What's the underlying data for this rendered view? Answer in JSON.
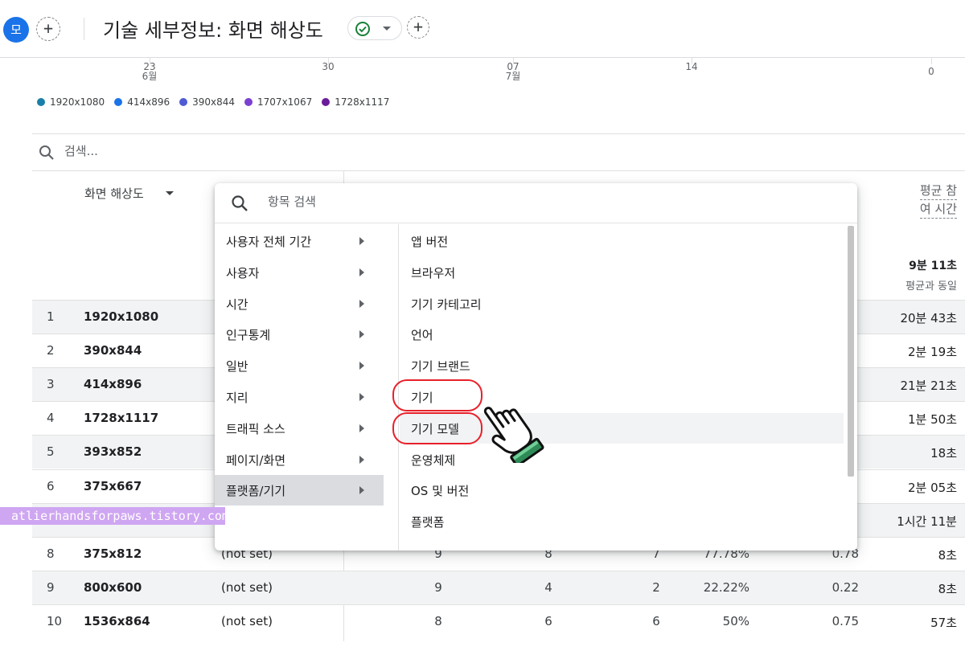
{
  "header": {
    "avatar_label": "모",
    "add_label": "+",
    "title": "기술 세부정보: 화면 해상도",
    "add_comparison_label": "+"
  },
  "chart_axis": {
    "ticks": [
      {
        "label": "23",
        "sub": "6월"
      },
      {
        "label": "30",
        "sub": ""
      },
      {
        "label": "07",
        "sub": "7월"
      },
      {
        "label": "14",
        "sub": ""
      },
      {
        "label": "0",
        "sub": ""
      }
    ]
  },
  "legend": [
    {
      "label": "1920x1080",
      "color": "#1a7fa8"
    },
    {
      "label": "414x896",
      "color": "#1a73e8"
    },
    {
      "label": "390x844",
      "color": "#4f5bd5"
    },
    {
      "label": "1707x1067",
      "color": "#7b3fd1"
    },
    {
      "label": "1728x1117",
      "color": "#6a1b9a"
    }
  ],
  "table": {
    "search_placeholder": "검색...",
    "dimension_header": "화면 해상도",
    "metric_header_line1": "평균 참",
    "metric_header_line2": "여 시간",
    "metric_total": "9분 11초",
    "metric_total_sub": "평균과 동일",
    "rows": [
      {
        "idx": "1",
        "res": "1920x1080",
        "ns": "",
        "n1": "",
        "n2": "",
        "n3": "",
        "n4": "",
        "n5": "",
        "n6": "20분 43초"
      },
      {
        "idx": "2",
        "res": "390x844",
        "ns": "",
        "n1": "",
        "n2": "",
        "n3": "",
        "n4": "",
        "n5": "",
        "n6": "2분 19초"
      },
      {
        "idx": "3",
        "res": "414x896",
        "ns": "",
        "n1": "",
        "n2": "",
        "n3": "",
        "n4": "",
        "n5": "",
        "n6": "21분 21초"
      },
      {
        "idx": "4",
        "res": "1728x1117",
        "ns": "",
        "n1": "",
        "n2": "",
        "n3": "",
        "n4": "",
        "n5": "",
        "n6": "1분 50초"
      },
      {
        "idx": "5",
        "res": "393x852",
        "ns": "",
        "n1": "",
        "n2": "",
        "n3": "",
        "n4": "",
        "n5": "",
        "n6": "18초"
      },
      {
        "idx": "6",
        "res": "375x667",
        "ns": "",
        "n1": "",
        "n2": "",
        "n3": "",
        "n4": "",
        "n5": "",
        "n6": "2분 05초"
      },
      {
        "idx": "",
        "res": "",
        "ns": "",
        "n1": "",
        "n2": "",
        "n3": "",
        "n4": "",
        "n5": "",
        "n6": "1시간 11분"
      },
      {
        "idx": "8",
        "res": "375x812",
        "ns": "(not set)",
        "n1": "9",
        "n2": "8",
        "n3": "7",
        "n4": "77.78%",
        "n5": "0.78",
        "n6": "8초"
      },
      {
        "idx": "9",
        "res": "800x600",
        "ns": "(not set)",
        "n1": "9",
        "n2": "4",
        "n3": "2",
        "n4": "22.22%",
        "n5": "0.22",
        "n6": "8초"
      },
      {
        "idx": "10",
        "res": "1536x864",
        "ns": "(not set)",
        "n1": "8",
        "n2": "6",
        "n3": "6",
        "n4": "50%",
        "n5": "0.75",
        "n6": "57초"
      }
    ]
  },
  "menu": {
    "search_placeholder": "항목 검색",
    "categories": [
      {
        "label": "사용자 전체 기간"
      },
      {
        "label": "사용자"
      },
      {
        "label": "시간"
      },
      {
        "label": "인구통계"
      },
      {
        "label": "일반"
      },
      {
        "label": "지리"
      },
      {
        "label": "트래픽 소스"
      },
      {
        "label": "페이지/화면"
      },
      {
        "label": "플랫폼/기기"
      }
    ],
    "active_category": "플랫폼/기기",
    "options": [
      {
        "label": "앱 버전"
      },
      {
        "label": "브라우저"
      },
      {
        "label": "기기 카테고리"
      },
      {
        "label": "언어"
      },
      {
        "label": "기기 브랜드"
      },
      {
        "label": "기기"
      },
      {
        "label": "기기 모델"
      },
      {
        "label": "운영체제"
      },
      {
        "label": "OS 및 버전"
      },
      {
        "label": "플랫폼"
      }
    ],
    "hovered_option": "기기 모델",
    "highlighted_options": [
      "기기",
      "기기 모델"
    ]
  },
  "watermark": "atlierhandsforpaws.tistory.com",
  "colors": {
    "accent": "#1a73e8",
    "highlight_ring": "#e8202a",
    "watermark_bg": "#cfa6f2",
    "check": "#188038"
  }
}
